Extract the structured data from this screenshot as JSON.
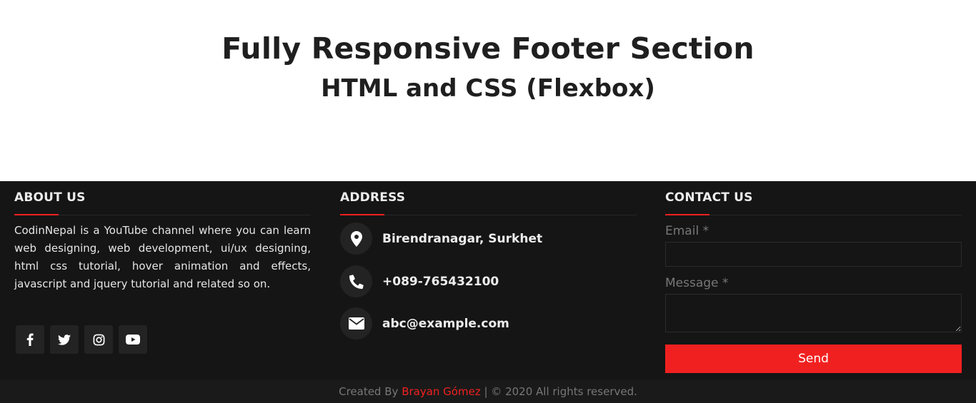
{
  "hero": {
    "title": "Fully Responsive Footer Section",
    "subtitle": "HTML and CSS (Flexbox)"
  },
  "footer": {
    "about": {
      "title": "ABOUT US",
      "text": "CodinNepal is a YouTube channel where you can learn web designing, web development, ui/ux designing, html css tutorial, hover animation and effects, javascript and jquery tutorial and related so on.",
      "socials": [
        {
          "icon": "facebook-icon"
        },
        {
          "icon": "twitter-icon"
        },
        {
          "icon": "instagram-icon"
        },
        {
          "icon": "youtube-icon"
        }
      ]
    },
    "address": {
      "title": "ADDRESS",
      "location": "Birendranagar, Surkhet",
      "phone": "+089-765432100",
      "email": "abc@example.com",
      "icons": [
        "map-marker-icon",
        "phone-icon",
        "envelope-icon"
      ]
    },
    "contact": {
      "title": "CONTACT US",
      "email_label": "Email *",
      "email_value": "",
      "message_label": "Message *",
      "message_value": "",
      "send_label": "Send"
    },
    "bottom": {
      "prefix": "Created By",
      "author": "Brayan Gómez",
      "suffix": "| © 2020 All rights reserved."
    }
  },
  "colors": {
    "accent": "#f12020",
    "footer_bg": "#151515",
    "icon_bg": "#232323"
  }
}
